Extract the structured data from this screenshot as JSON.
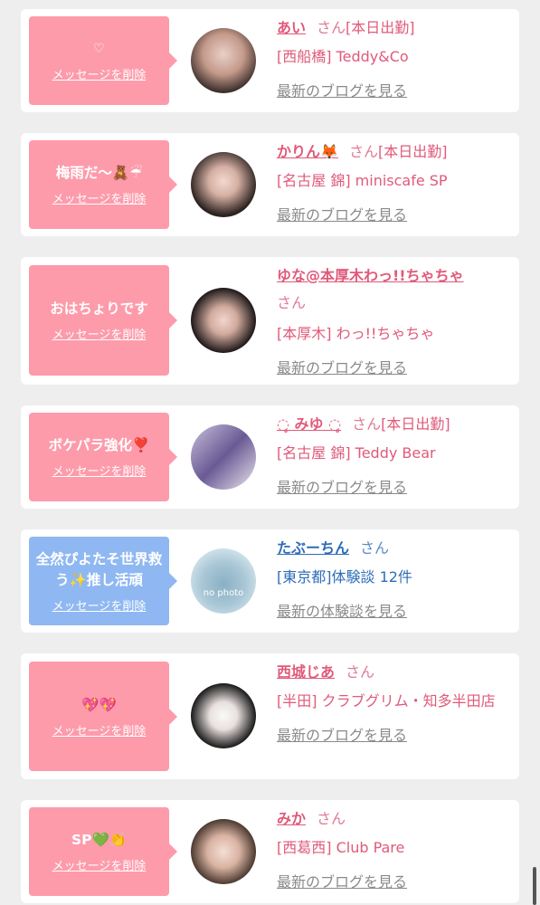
{
  "entries": [
    {
      "message": "♡",
      "delete_label": "メッセージを削除",
      "name": "あい",
      "san": "さん",
      "status": "[本日出勤]",
      "shop": "[西船橋] Teddy&Co",
      "link": "最新のブログを見る",
      "type": "pink"
    },
    {
      "message": "梅雨だ〜🧸☔",
      "delete_label": "メッセージを削除",
      "name": "かりん🦊",
      "san": "さん",
      "status": "[本日出勤]",
      "shop": "[名古屋 錦] miniscafe SP",
      "link": "最新のブログを見る",
      "type": "pink"
    },
    {
      "message": "おはちょりです",
      "delete_label": "メッセージを削除",
      "name": "ゆな@本厚木わっ!!ちゃちゃ",
      "san": "さん",
      "status": "",
      "shop": "[本厚木] わっ!!ちゃちゃ",
      "link": "最新のブログを見る",
      "type": "pink"
    },
    {
      "message": "ボケパラ強化❣️",
      "delete_label": "メッセージを削除",
      "name": "◌̥ みゆ ◌̥",
      "san": "さん",
      "status": "[本日出勤]",
      "shop": "[名古屋 錦] Teddy Bear",
      "link": "最新のブログを見る",
      "type": "pink"
    },
    {
      "message": "全然ぴよたそ世界救う✨推し活頑",
      "delete_label": "メッセージを削除",
      "name": "たぶーちん",
      "san": "さん",
      "status": "",
      "shop": "[東京都]体験談 12件",
      "link": "最新の体験談を見る",
      "type": "blue",
      "avatar_text": "no photo"
    },
    {
      "message": "💖💖",
      "delete_label": "メッセージを削除",
      "name": "西城じあ",
      "san": "さん",
      "status": "",
      "shop": "[半田] クラブグリム・知多半田店",
      "link": "最新のブログを見る",
      "type": "pink"
    },
    {
      "message": "SP💚👏",
      "delete_label": "メッセージを削除",
      "name": "みか",
      "san": "さん",
      "status": "",
      "shop": "[西葛西] Club Pare",
      "link": "最新のブログを見る",
      "type": "pink"
    }
  ],
  "colors": {
    "pink": "#fd9bab",
    "blue": "#8fb8f2",
    "name_pink": "#e05a7a",
    "name_blue": "#2e6db8"
  }
}
